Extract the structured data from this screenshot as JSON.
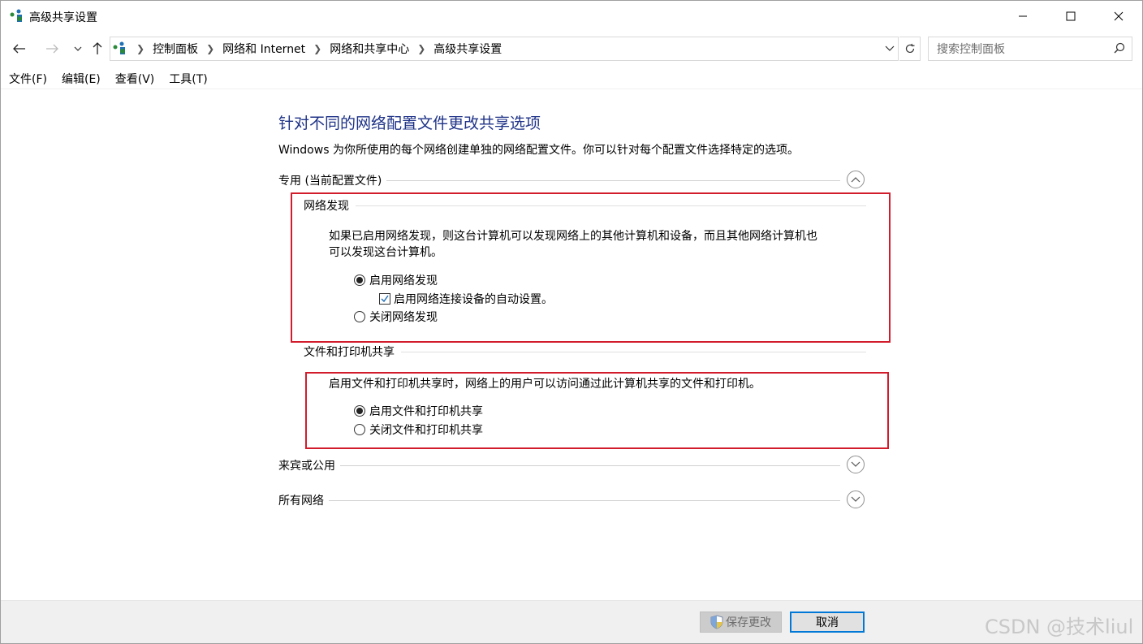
{
  "window": {
    "title": "高级共享设置"
  },
  "breadcrumb": [
    "控制面板",
    "网络和 Internet",
    "网络和共享中心",
    "高级共享设置"
  ],
  "search": {
    "placeholder": "搜索控制面板"
  },
  "menu": [
    "文件(F)",
    "编辑(E)",
    "查看(V)",
    "工具(T)"
  ],
  "main": {
    "heading": "针对不同的网络配置文件更改共享选项",
    "intro": "Windows 为你所使用的每个网络创建单独的网络配置文件。你可以针对每个配置文件选择特定的选项。",
    "private_profile": {
      "label": "专用 (当前配置文件)",
      "network_discovery": {
        "title": "网络发现",
        "description_line1": "如果已启用网络发现，则这台计算机可以发现网络上的其他计算机和设备，而且其他网络计算机也",
        "description_line2": "可以发现这台计算机。",
        "option_on": "启用网络发现",
        "option_auto_setup": "启用网络连接设备的自动设置。",
        "option_off": "关闭网络发现",
        "selected": "on",
        "auto_setup_checked": true
      },
      "file_printer_sharing": {
        "title": "文件和打印机共享",
        "description": "启用文件和打印机共享时，网络上的用户可以访问通过此计算机共享的文件和打印机。",
        "option_on": "启用文件和打印机共享",
        "option_off": "关闭文件和打印机共享",
        "selected": "on"
      }
    },
    "guest_public": {
      "label": "来宾或公用"
    },
    "all_networks": {
      "label": "所有网络"
    }
  },
  "footer": {
    "save_label": "保存更改",
    "cancel_label": "取消",
    "watermark": "CSDN @技术liul"
  },
  "colors": {
    "heading": "#1e3287",
    "highlight_box": "#d21c2c",
    "default_button_border": "#0078d7"
  }
}
